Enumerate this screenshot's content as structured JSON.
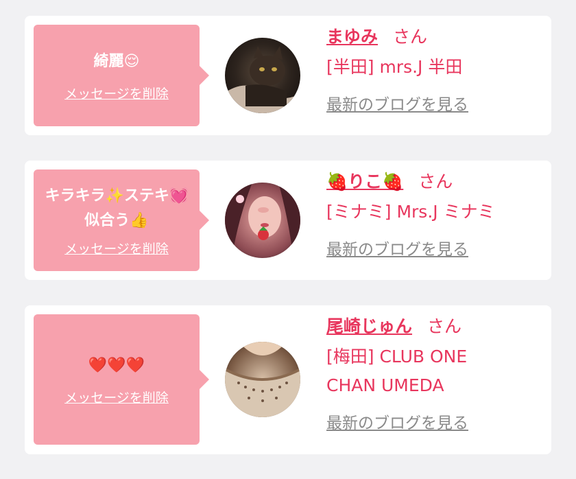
{
  "messages": [
    {
      "text": "綺麗😌",
      "delete_label": "メッセージを削除",
      "name": "まゆみ",
      "honorific": "さん",
      "shop_line1": "[半田] mrs.J 半田",
      "shop_line2": "",
      "blog_label": "最新のブログを見る"
    },
    {
      "text": "キラキラ✨ステキ💓似合う👍",
      "delete_label": "メッセージを削除",
      "name": "🍓りこ🍓",
      "honorific": "さん",
      "shop_line1": "[ミナミ] Mrs.J ミナミ",
      "shop_line2": "",
      "blog_label": "最新のブログを見る"
    },
    {
      "text": "❤️❤️❤️",
      "delete_label": "メッセージを削除",
      "name": "尾崎じゅん",
      "honorific": "さん",
      "shop_line1": "[梅田] CLUB ONE",
      "shop_line2": "CHAN UMEDA",
      "blog_label": "最新のブログを見る"
    }
  ],
  "colors": {
    "bubble": "#f7a1ad",
    "accent": "#e8365d",
    "link_gray": "#8a8a8a",
    "background": "#f1f1f3"
  }
}
